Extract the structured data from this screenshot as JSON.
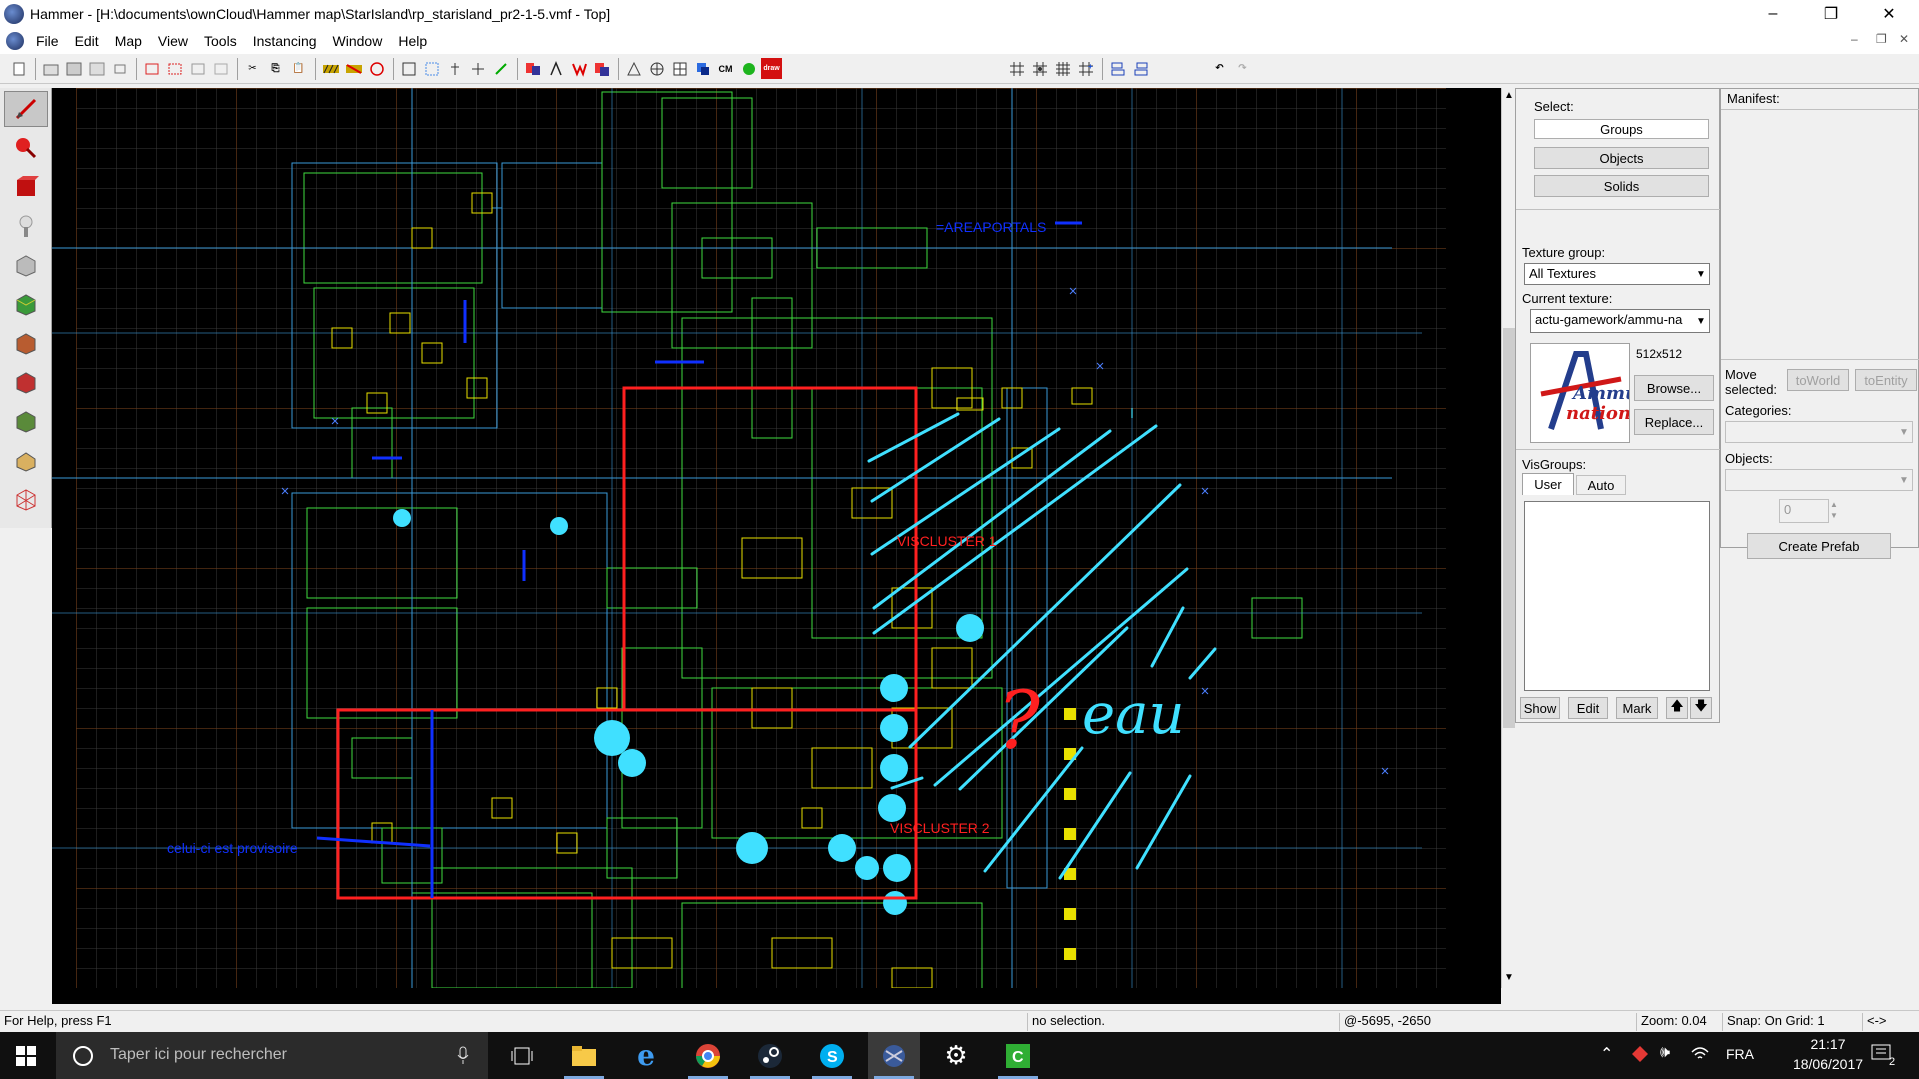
{
  "window": {
    "title": "Hammer - [H:\\documents\\ownCloud\\Hammer map\\StarIsland\\rp_starisland_pr2-1-5.vmf - Top]",
    "controls": [
      "–",
      "❐",
      "✕"
    ]
  },
  "menu": {
    "items": [
      "File",
      "Edit",
      "Map",
      "View",
      "Tools",
      "Instancing",
      "Window",
      "Help"
    ],
    "mdi_controls": [
      "–",
      "❐",
      "✕"
    ]
  },
  "toolbar": {
    "cm_label": "CM",
    "draw_label": "draw"
  },
  "tools": [
    "selection-tool",
    "magnify-tool",
    "camera-tool",
    "entity-tool",
    "block-tool",
    "texture-tool",
    "apply-texture-tool",
    "decal-tool",
    "overlay-tool",
    "clip-tool",
    "vertex-tool"
  ],
  "viewport": {
    "annotations": {
      "areaportals": "=AREAPORTALS",
      "viscluster1": "VISCLUSTER 1",
      "viscluster2": "VISCLUSTER 2",
      "provisoire": "celui-ci est provisoire",
      "eau": "eau",
      "question": "?"
    },
    "colors": {
      "grid": "#3a3a3a",
      "grid_major": "#6a3b1a",
      "brush_cyan": "#40e0ff",
      "brush_green": "#3fdc3f",
      "brush_yellow": "#e8e000",
      "viscluster": "#ff2020",
      "areaportal": "#1030ff"
    }
  },
  "select_panel": {
    "heading": "Select:",
    "groups": "Groups",
    "objects": "Objects",
    "solids": "Solids"
  },
  "texture_panel": {
    "group_label": "Texture group:",
    "group_value": "All Textures",
    "current_label": "Current texture:",
    "current_value": "actu-gamework/ammu-na",
    "size": "512x512",
    "browse": "Browse...",
    "replace": "Replace...",
    "logo_text_1": "Ammu",
    "logo_text_2": "nation"
  },
  "visgroups": {
    "heading": "VisGroups:",
    "tab_user": "User",
    "tab_auto": "Auto",
    "show": "Show",
    "edit": "Edit",
    "mark": "Mark",
    "up": "🡅",
    "down": "🡇"
  },
  "manifest": {
    "heading": "Manifest:",
    "move_selected": "Move selected:",
    "to_world": "toWorld",
    "to_entity": "toEntity",
    "categories": "Categories:",
    "objects": "Objects:",
    "spin_value": "0",
    "create_prefab": "Create Prefab"
  },
  "status": {
    "help": "For Help, press F1",
    "selection": "no selection.",
    "coords": "@-5695, -2650",
    "zoom": "Zoom: 0.04",
    "snap": "Snap: On Grid: 1",
    "arrows": "<->"
  },
  "taskbar": {
    "search_placeholder": "Taper ici pour rechercher",
    "language": "FRA",
    "time": "21:17",
    "date": "18/06/2017",
    "notifications": "2"
  }
}
